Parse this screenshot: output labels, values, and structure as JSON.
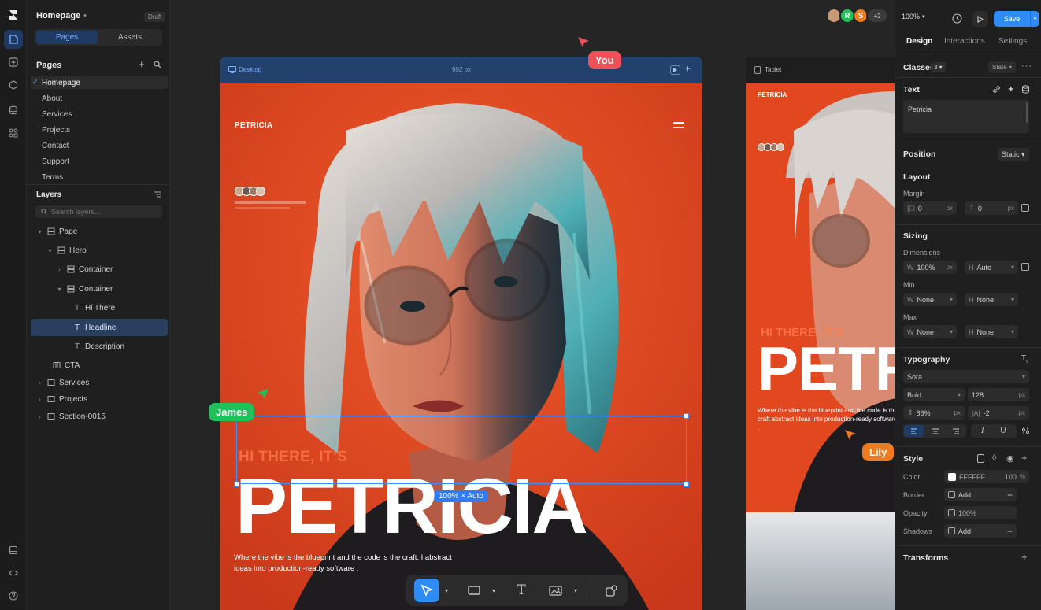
{
  "project": {
    "name": "Homepage",
    "status": "Draft"
  },
  "left_tabs": {
    "pages": "Pages",
    "assets": "Assets"
  },
  "pages": {
    "title": "Pages",
    "items": [
      "Homepage",
      "About",
      "Services",
      "Projects",
      "Contact",
      "Support",
      "Terms"
    ]
  },
  "layers": {
    "title": "Layers",
    "search_placeholder": "Search layers...",
    "items": [
      "Page",
      "Hero",
      "Container",
      "Container",
      "Hi There",
      "Headline",
      "Description",
      "CTA",
      "Services",
      "Projects",
      "Section-0015"
    ]
  },
  "canvas": {
    "desktop_label": "Desktop",
    "desktop_width": "992 px",
    "tablet_label": "Tablet",
    "size_badge": "100% × Auto",
    "site": {
      "logo": "PETRICIA",
      "hi_there": "HI THERE, IT’S",
      "headline": "PETRICIA",
      "description": "Where the vibe is the blueprint and the code is the craft. I abstract ideas into production-ready software .",
      "tablet_headline": "PETR",
      "tablet_description": "Where the vibe is the blueprint and the code is the craft abstract ideas into production-ready software ."
    }
  },
  "collaborators": {
    "you": "You",
    "james": "James",
    "lily": "Lily",
    "avatar_r": "R",
    "avatar_s": "S",
    "more": "+2"
  },
  "topbar": {
    "zoom": "100%",
    "save": "Save"
  },
  "right": {
    "tabs": [
      "Design",
      "Interactions",
      "Settings"
    ],
    "classes": {
      "label": "Classes",
      "count": "3",
      "state": "State"
    },
    "text": {
      "label": "Text",
      "value": "Petricia"
    },
    "position": {
      "label": "Position",
      "value": "Static"
    },
    "layout": {
      "label": "Layout",
      "margin": "Margin",
      "left": "0",
      "top": "0",
      "unit": "px"
    },
    "sizing": {
      "label": "Sizing",
      "dimensions": "Dimensions",
      "w": "100%",
      "h": "Auto",
      "min": "Min",
      "max": "Max",
      "none": "None",
      "w_key": "W",
      "h_key": "H"
    },
    "typography": {
      "label": "Typography",
      "font": "Sora",
      "weight": "Bold",
      "size": "128",
      "line_height": "86%",
      "letter_spacing": "-2",
      "unit": "px"
    },
    "style": {
      "label": "Style",
      "color": "Color",
      "color_hex": "FFFFFF",
      "color_opacity": "100",
      "pct": "%",
      "border": "Border",
      "add": "Add",
      "opacity": "Opacity",
      "opacity_value": "100%",
      "shadows": "Shadows"
    },
    "transforms": {
      "label": "Transforms"
    }
  },
  "colors": {
    "accent": "#2f7cf6",
    "you": "#f0505a",
    "james": "#1fc25a",
    "lily": "#f07a1e",
    "hero": "#e24820"
  }
}
